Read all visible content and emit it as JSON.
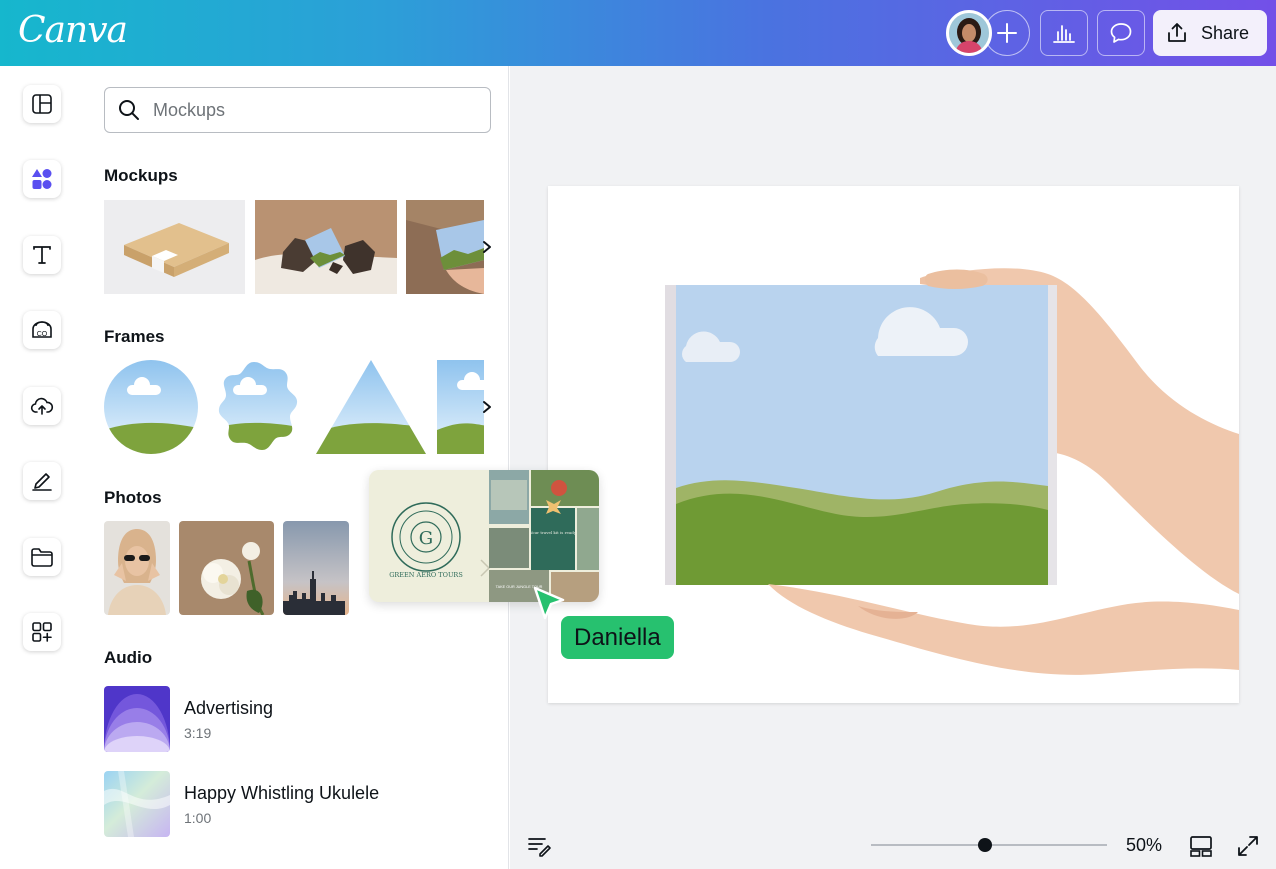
{
  "app": {
    "logo_text": "Canva"
  },
  "header": {
    "share_label": "Share",
    "collaborator_name": "Daniella"
  },
  "rail": {
    "items": [
      "design",
      "elements",
      "text",
      "brand",
      "uploads",
      "draw",
      "projects",
      "apps"
    ]
  },
  "panel": {
    "search": {
      "placeholder": "Mockups"
    },
    "sections": {
      "mockups": "Mockups",
      "frames": "Frames",
      "photos": "Photos",
      "audio": "Audio"
    },
    "audio_items": [
      {
        "title": "Advertising",
        "duration": "3:19"
      },
      {
        "title": "Happy Whistling Ukulele",
        "duration": "1:00"
      }
    ]
  },
  "drag_card": {
    "logo_text": "GREEN AERO TOURS",
    "logo_letter": "G",
    "caption": "Your travel kit is ready",
    "promo": "TAKE OUR JUNGLE TOUR"
  },
  "footer": {
    "zoom": "50%",
    "zoom_fraction": 0.48
  },
  "colors": {
    "accent": "#7350e8",
    "cursor": "#27c16f",
    "sky": "#b6d3ef",
    "grass": "#6f9a34"
  }
}
